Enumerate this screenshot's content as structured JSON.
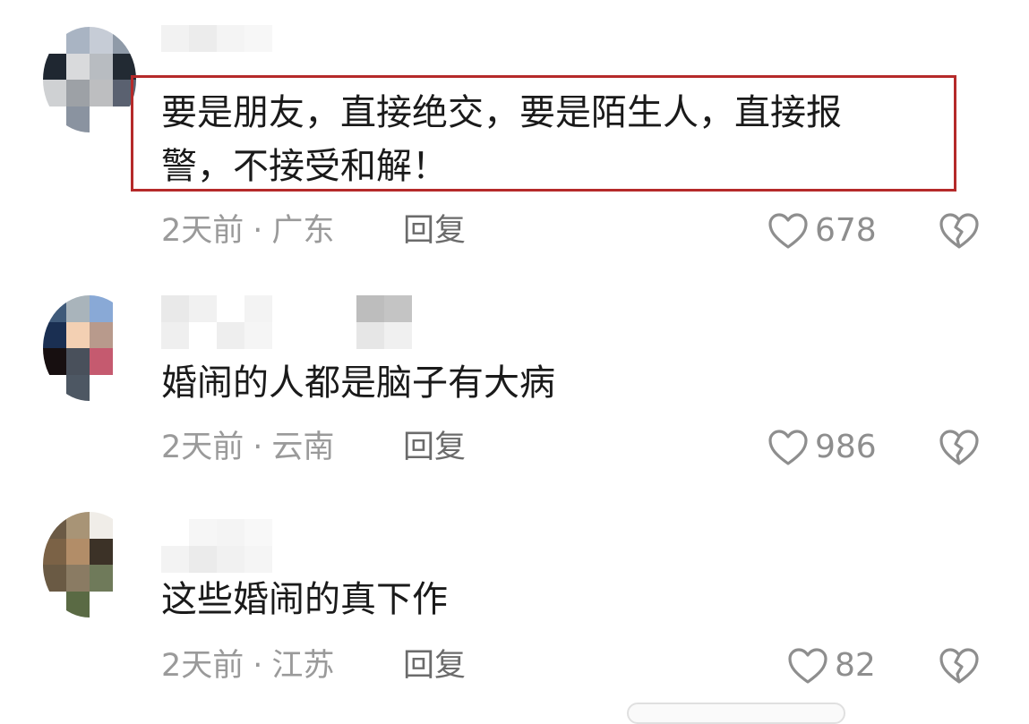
{
  "comments": [
    {
      "text": "要是朋友，直接绝交，要是陌生人，直接报\n警，不接受和解！",
      "time": "2天前",
      "location": "广东",
      "reply_label": "回复",
      "likes": "678",
      "highlighted": true,
      "avatar_colors": [
        "#ffffff",
        "#a9b4c3",
        "#c6ccd6",
        "#8f9aa8",
        "#1f2731",
        "#d9dadc",
        "#b8bcc1",
        "#222a33",
        "#cfd1d3",
        "#9da1a6",
        "#bdbec0",
        "#5a6170",
        "#ffffff",
        "#8a93a0",
        "#ffffff",
        "#ffffff"
      ]
    },
    {
      "text": "婚闹的人都是脑子有大病",
      "time": "2天前",
      "location": "云南",
      "reply_label": "回复",
      "likes": "986",
      "highlighted": false,
      "avatar_colors": [
        "#3f5a7a",
        "#a9b4bb",
        "#89a9d6",
        "#ffffff",
        "#1a2f52",
        "#f3d0b3",
        "#b89a8c",
        "#ffffff",
        "#170f10",
        "#49505b",
        "#c55a6f",
        "#ffffff",
        "#ffffff",
        "#4d5763",
        "#ffffff",
        "#ffffff"
      ]
    },
    {
      "text": "这些婚闹的真下作",
      "time": "2天前",
      "location": "江苏",
      "reply_label": "回复",
      "likes": "82",
      "highlighted": false,
      "avatar_colors": [
        "#6b5a45",
        "#a89476",
        "#f0ede8",
        "#ffffff",
        "#7b6246",
        "#b28d68",
        "#3c3227",
        "#ffffff",
        "#6a5a44",
        "#8a7b63",
        "#6f7a5a",
        "#ffffff",
        "#ffffff",
        "#5a6a44",
        "#ffffff",
        "#ffffff"
      ]
    }
  ],
  "icons": {
    "like": "heart-outline-icon",
    "dislike": "broken-heart-icon"
  },
  "colors": {
    "highlight_border": "#b52a2a",
    "meta_text": "#9a9a9a"
  }
}
